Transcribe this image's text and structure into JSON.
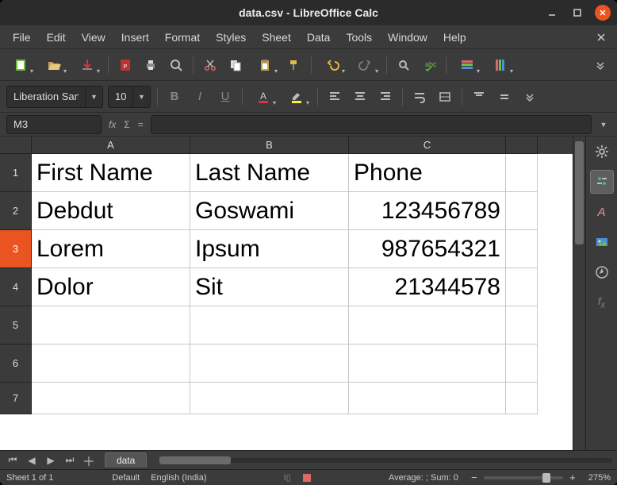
{
  "window": {
    "title": "data.csv - LibreOffice Calc"
  },
  "menu": {
    "items": [
      "File",
      "Edit",
      "View",
      "Insert",
      "Format",
      "Styles",
      "Sheet",
      "Data",
      "Tools",
      "Window",
      "Help"
    ]
  },
  "format": {
    "font_name": "Liberation Sans",
    "font_size": "10"
  },
  "namebox": {
    "value": "M3"
  },
  "formula": {
    "value": ""
  },
  "columns": [
    "A",
    "B",
    "C"
  ],
  "rows_visible": [
    "1",
    "2",
    "3",
    "4",
    "5",
    "6",
    "7"
  ],
  "selected_row": "3",
  "sheet": {
    "headers": {
      "A": "First Name",
      "B": "Last Name",
      "C": "Phone"
    },
    "data": [
      {
        "A": "Debdut",
        "B": "Goswami",
        "C": "123456789"
      },
      {
        "A": "Lorem",
        "B": "Ipsum",
        "C": "987654321"
      },
      {
        "A": "Dolor",
        "B": "Sit",
        "C": "21344578"
      }
    ]
  },
  "tabs": {
    "active": "data"
  },
  "status": {
    "sheet_info": "Sheet 1 of 1",
    "style": "Default",
    "language": "English (India)",
    "summary": "Average: ; Sum: 0",
    "zoom": "275%"
  },
  "chart_data": {
    "type": "table",
    "columns": [
      "First Name",
      "Last Name",
      "Phone"
    ],
    "rows": [
      [
        "Debdut",
        "Goswami",
        123456789
      ],
      [
        "Lorem",
        "Ipsum",
        987654321
      ],
      [
        "Dolor",
        "Sit",
        21344578
      ]
    ]
  }
}
